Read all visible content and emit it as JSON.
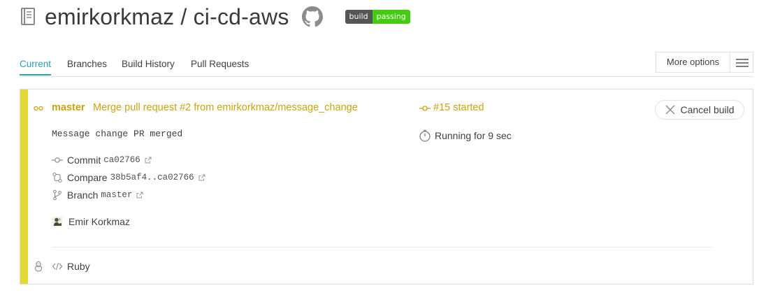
{
  "repo": {
    "title": "emirkorkmaz / ci-cd-aws",
    "badge_left": "build",
    "badge_right": "passing",
    "badge_colors": {
      "left": "#555555",
      "right": "#44cc11"
    }
  },
  "tabs": [
    {
      "label": "Current",
      "active": true
    },
    {
      "label": "Branches"
    },
    {
      "label": "Build History"
    },
    {
      "label": "Pull Requests"
    }
  ],
  "more_options": {
    "label": "More options"
  },
  "build": {
    "state_color": "#e4d836",
    "branch": "master",
    "commit_message": "Merge pull request #2 from emirkorkmaz/message_change",
    "message": "Message change PR merged",
    "commit_label": "Commit",
    "commit_sha": "ca02766",
    "compare_label": "Compare",
    "compare_range": "38b5af4..ca02766",
    "branch_label": "Branch",
    "branch_value": "master",
    "author": "Emir Korkmaz",
    "build_number": "#15 started",
    "duration": "Running for 9 sec",
    "cancel_label": "Cancel build",
    "language": "Ruby"
  },
  "icons": [
    "repo-icon",
    "github-icon",
    "commit-icon",
    "compare-icon",
    "branch-icon",
    "stopwatch-icon",
    "external-link-icon",
    "close-icon",
    "linux-icon",
    "code-icon",
    "hamburger-icon"
  ]
}
